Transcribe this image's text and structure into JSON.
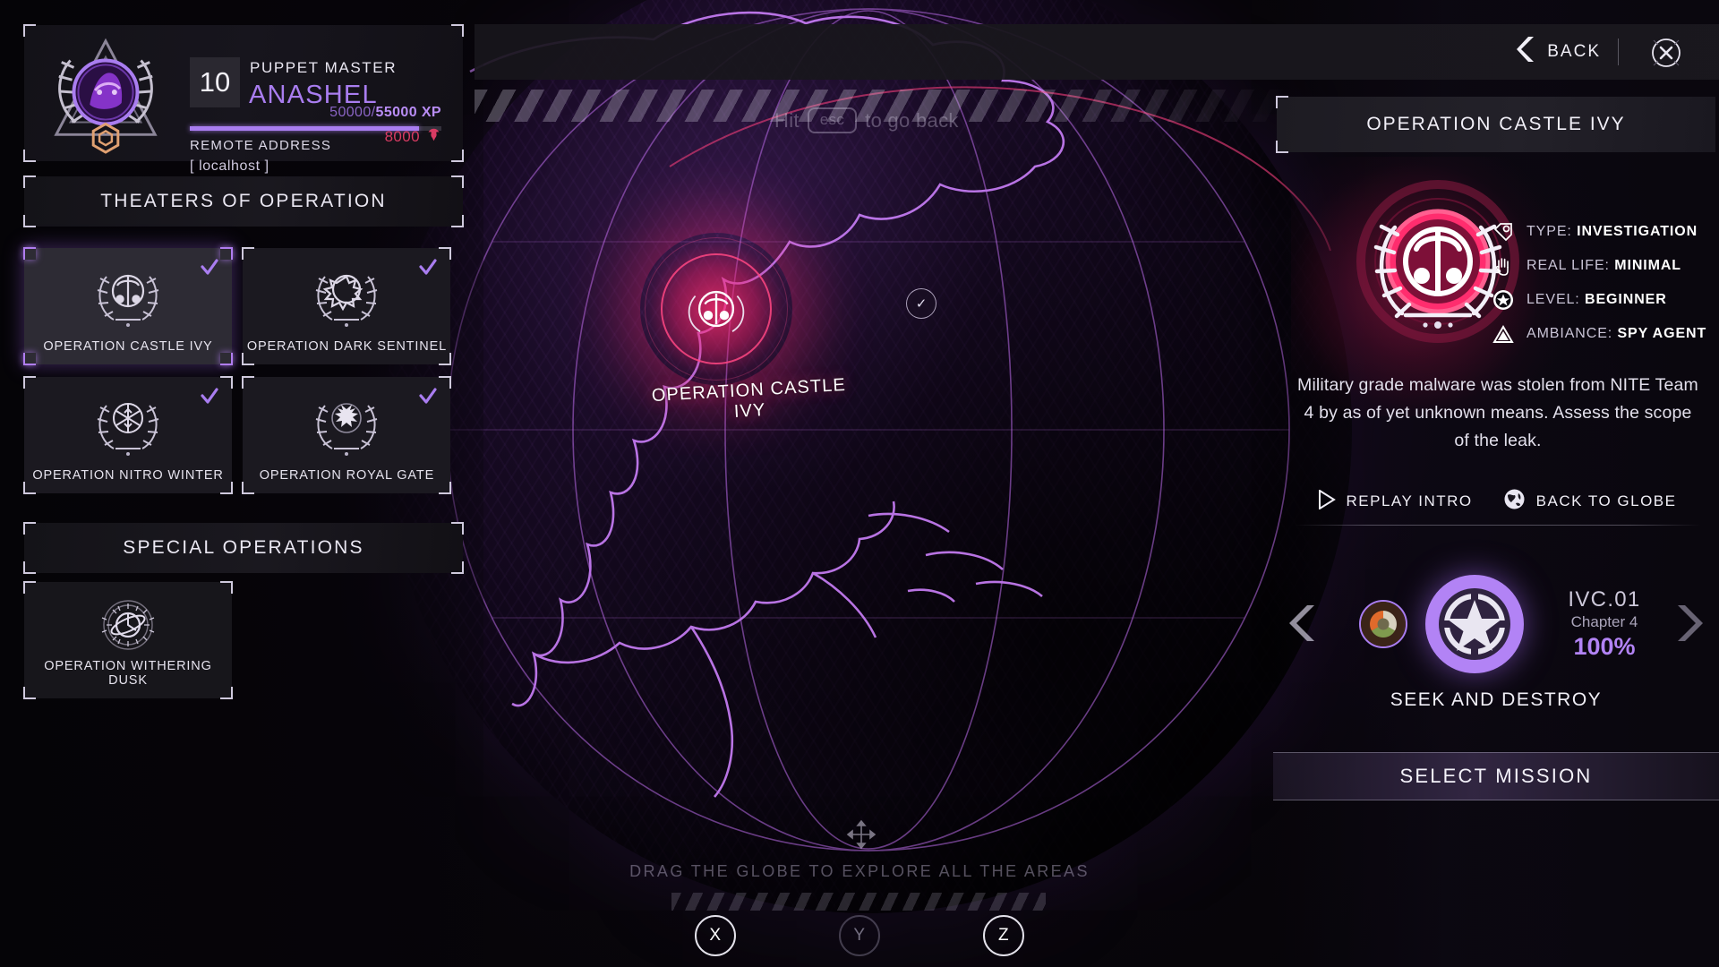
{
  "profile": {
    "rank": "10",
    "title": "PUPPET MASTER",
    "name": "ANASHEL",
    "xp_current": "50000",
    "xp_separator": "/",
    "xp_max": "55000 XP",
    "xp_percent": 91,
    "remote_label": "REMOTE ADDRESS",
    "remote_value": "[ localhost ]",
    "currency": "8000",
    "currency_icon": "crest-token-icon",
    "accent": "#a97df0",
    "currency_color": "#d93b63"
  },
  "sections": {
    "theaters_label": "THEATERS OF OPERATION",
    "special_label": "SPECIAL OPERATIONS"
  },
  "theaters": [
    {
      "label": "OPERATION CASTLE IVY",
      "icon": "laurel-shield-icon",
      "completed": true,
      "selected": true
    },
    {
      "label": "OPERATION DARK SENTINEL",
      "icon": "laurel-gear-icon",
      "completed": true,
      "selected": false
    },
    {
      "label": "OPERATION NITRO WINTER",
      "icon": "laurel-snowflake-icon",
      "completed": true,
      "selected": false
    },
    {
      "label": "OPERATION ROYAL GATE",
      "icon": "laurel-eagle-icon",
      "completed": true,
      "selected": false
    }
  ],
  "special_ops": [
    {
      "label": "OPERATION WITHERING DUSK",
      "icon": "laurel-orbit-icon",
      "completed": false,
      "selected": false
    }
  ],
  "top_bar": {
    "back_label": "BACK",
    "back_icon": "chevron-left-icon",
    "close_icon": "close-icon"
  },
  "globe": {
    "esc_hint_prefix": "Hit",
    "esc_key": "esc",
    "esc_hint_suffix": "to go back",
    "hotspot_label": "OPERATION CASTLE IVY",
    "drag_hint": "DRAG THE GLOBE TO EXPLORE ALL THE AREAS",
    "axes": [
      {
        "label": "X",
        "active": true
      },
      {
        "label": "Y",
        "active": false
      },
      {
        "label": "Z",
        "active": true
      }
    ],
    "node_icon": "check-node-icon"
  },
  "operation": {
    "title": "OPERATION CASTLE IVY",
    "emblem_icon": "castle-ivy-crest-icon",
    "attributes": [
      {
        "icon": "tag-icon",
        "label": "TYPE:",
        "value": "INVESTIGATION"
      },
      {
        "icon": "hand-icon",
        "label": "REAL LIFE:",
        "value": "MINIMAL"
      },
      {
        "icon": "star-badge-icon",
        "label": "LEVEL:",
        "value": "BEGINNER"
      },
      {
        "icon": "triangle-icon",
        "label": "AMBIANCE:",
        "value": "SPY AGENT"
      }
    ],
    "description": "Military grade malware was stolen from NITE Team 4 by as of yet unknown means. Assess the scope of the leak.",
    "actions": [
      {
        "icon": "play-icon",
        "label": "REPLAY INTRO"
      },
      {
        "icon": "globe-icon",
        "label": "BACK TO GLOBE"
      }
    ],
    "mission": {
      "prev_icon": "mission-prev-icon",
      "current_icon": "star-circle-icon",
      "code": "IVC.01",
      "chapter": "Chapter 4",
      "progress": "100%",
      "name": "SEEK AND DESTROY",
      "prev_arrow": "chevron-left-icon",
      "next_arrow": "chevron-right-icon"
    },
    "select_label": "SELECT MISSION"
  }
}
